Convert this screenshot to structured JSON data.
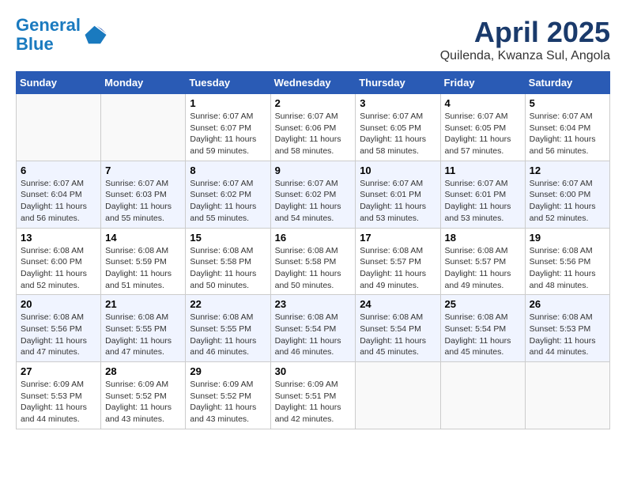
{
  "logo": {
    "line1": "General",
    "line2": "Blue"
  },
  "title": "April 2025",
  "subtitle": "Quilenda, Kwanza Sul, Angola",
  "headers": [
    "Sunday",
    "Monday",
    "Tuesday",
    "Wednesday",
    "Thursday",
    "Friday",
    "Saturday"
  ],
  "weeks": [
    [
      {
        "day": "",
        "info": ""
      },
      {
        "day": "",
        "info": ""
      },
      {
        "day": "1",
        "info": "Sunrise: 6:07 AM\nSunset: 6:07 PM\nDaylight: 11 hours and 59 minutes."
      },
      {
        "day": "2",
        "info": "Sunrise: 6:07 AM\nSunset: 6:06 PM\nDaylight: 11 hours and 58 minutes."
      },
      {
        "day": "3",
        "info": "Sunrise: 6:07 AM\nSunset: 6:05 PM\nDaylight: 11 hours and 58 minutes."
      },
      {
        "day": "4",
        "info": "Sunrise: 6:07 AM\nSunset: 6:05 PM\nDaylight: 11 hours and 57 minutes."
      },
      {
        "day": "5",
        "info": "Sunrise: 6:07 AM\nSunset: 6:04 PM\nDaylight: 11 hours and 56 minutes."
      }
    ],
    [
      {
        "day": "6",
        "info": "Sunrise: 6:07 AM\nSunset: 6:04 PM\nDaylight: 11 hours and 56 minutes."
      },
      {
        "day": "7",
        "info": "Sunrise: 6:07 AM\nSunset: 6:03 PM\nDaylight: 11 hours and 55 minutes."
      },
      {
        "day": "8",
        "info": "Sunrise: 6:07 AM\nSunset: 6:02 PM\nDaylight: 11 hours and 55 minutes."
      },
      {
        "day": "9",
        "info": "Sunrise: 6:07 AM\nSunset: 6:02 PM\nDaylight: 11 hours and 54 minutes."
      },
      {
        "day": "10",
        "info": "Sunrise: 6:07 AM\nSunset: 6:01 PM\nDaylight: 11 hours and 53 minutes."
      },
      {
        "day": "11",
        "info": "Sunrise: 6:07 AM\nSunset: 6:01 PM\nDaylight: 11 hours and 53 minutes."
      },
      {
        "day": "12",
        "info": "Sunrise: 6:07 AM\nSunset: 6:00 PM\nDaylight: 11 hours and 52 minutes."
      }
    ],
    [
      {
        "day": "13",
        "info": "Sunrise: 6:08 AM\nSunset: 6:00 PM\nDaylight: 11 hours and 52 minutes."
      },
      {
        "day": "14",
        "info": "Sunrise: 6:08 AM\nSunset: 5:59 PM\nDaylight: 11 hours and 51 minutes."
      },
      {
        "day": "15",
        "info": "Sunrise: 6:08 AM\nSunset: 5:58 PM\nDaylight: 11 hours and 50 minutes."
      },
      {
        "day": "16",
        "info": "Sunrise: 6:08 AM\nSunset: 5:58 PM\nDaylight: 11 hours and 50 minutes."
      },
      {
        "day": "17",
        "info": "Sunrise: 6:08 AM\nSunset: 5:57 PM\nDaylight: 11 hours and 49 minutes."
      },
      {
        "day": "18",
        "info": "Sunrise: 6:08 AM\nSunset: 5:57 PM\nDaylight: 11 hours and 49 minutes."
      },
      {
        "day": "19",
        "info": "Sunrise: 6:08 AM\nSunset: 5:56 PM\nDaylight: 11 hours and 48 minutes."
      }
    ],
    [
      {
        "day": "20",
        "info": "Sunrise: 6:08 AM\nSunset: 5:56 PM\nDaylight: 11 hours and 47 minutes."
      },
      {
        "day": "21",
        "info": "Sunrise: 6:08 AM\nSunset: 5:55 PM\nDaylight: 11 hours and 47 minutes."
      },
      {
        "day": "22",
        "info": "Sunrise: 6:08 AM\nSunset: 5:55 PM\nDaylight: 11 hours and 46 minutes."
      },
      {
        "day": "23",
        "info": "Sunrise: 6:08 AM\nSunset: 5:54 PM\nDaylight: 11 hours and 46 minutes."
      },
      {
        "day": "24",
        "info": "Sunrise: 6:08 AM\nSunset: 5:54 PM\nDaylight: 11 hours and 45 minutes."
      },
      {
        "day": "25",
        "info": "Sunrise: 6:08 AM\nSunset: 5:54 PM\nDaylight: 11 hours and 45 minutes."
      },
      {
        "day": "26",
        "info": "Sunrise: 6:08 AM\nSunset: 5:53 PM\nDaylight: 11 hours and 44 minutes."
      }
    ],
    [
      {
        "day": "27",
        "info": "Sunrise: 6:09 AM\nSunset: 5:53 PM\nDaylight: 11 hours and 44 minutes."
      },
      {
        "day": "28",
        "info": "Sunrise: 6:09 AM\nSunset: 5:52 PM\nDaylight: 11 hours and 43 minutes."
      },
      {
        "day": "29",
        "info": "Sunrise: 6:09 AM\nSunset: 5:52 PM\nDaylight: 11 hours and 43 minutes."
      },
      {
        "day": "30",
        "info": "Sunrise: 6:09 AM\nSunset: 5:51 PM\nDaylight: 11 hours and 42 minutes."
      },
      {
        "day": "",
        "info": ""
      },
      {
        "day": "",
        "info": ""
      },
      {
        "day": "",
        "info": ""
      }
    ]
  ]
}
